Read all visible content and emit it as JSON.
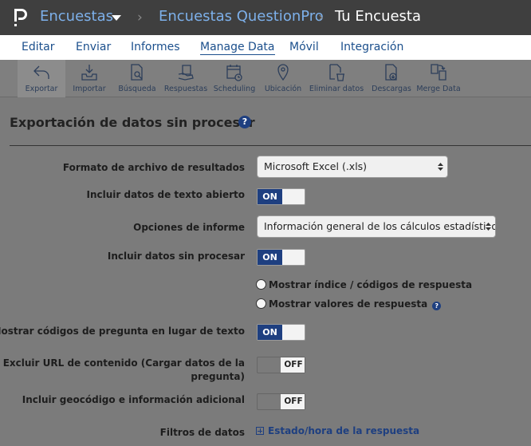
{
  "header": {
    "crumb1": "Encuestas",
    "crumb2": "Encuestas QuestionPro",
    "crumb3": "Tu Encuesta",
    "separator": "›"
  },
  "tabs": [
    {
      "label": "Editar"
    },
    {
      "label": "Enviar"
    },
    {
      "label": "Informes"
    },
    {
      "label": "Manage Data",
      "active": true
    },
    {
      "label": "Móvil"
    },
    {
      "label": "Integración"
    }
  ],
  "toolbar": [
    {
      "label": "Exportar",
      "icon": "export-arrow-icon",
      "active": true
    },
    {
      "label": "Importar",
      "icon": "import-tray-icon"
    },
    {
      "label": "Búsqueda",
      "icon": "search-document-icon"
    },
    {
      "label": "Respuestas",
      "icon": "responses-hand-icon"
    },
    {
      "label": "Scheduling",
      "icon": "calendar-icon"
    },
    {
      "label": "Ubicación",
      "icon": "location-pin-icon"
    },
    {
      "label": "Eliminar datos",
      "icon": "trash-icon"
    },
    {
      "label": "Descargas",
      "icon": "download-document-icon"
    },
    {
      "label": "Merge Data",
      "icon": "merge-documents-icon"
    }
  ],
  "page": {
    "title": "Exportación de datos sin procesar",
    "help": "?"
  },
  "form": {
    "format_label": "Formato de archivo de resultados",
    "format_value": "Microsoft Excel (.xls)",
    "open_text_label": "Incluir datos de texto abierto",
    "report_options_label": "Opciones de informe",
    "report_options_value": "Información general de los cálculos estadísticos y a",
    "raw_data_label": "Incluir datos sin procesar",
    "radio_index": "Mostrar índice / códigos de respuesta",
    "radio_values": "Mostrar valores de respuesta",
    "question_codes_label": "Mostrar códigos de pregunta en lugar de texto",
    "exclude_url_label_1": "Excluir URL de contenido (Cargar datos de la",
    "exclude_url_label_2": "pregunta)",
    "geocode_label": "Incluir geocódigo e información adicional",
    "filters_label": "Filtros de datos",
    "filter_link": "Estado/hora de la respuesta",
    "on_text": "ON",
    "off_text": "OFF"
  },
  "colors": {
    "topbar": "#3f3f3f",
    "link_blue": "#7db0ea",
    "accent": "#1e3f80",
    "overlay_gray": "#7b7b7b"
  }
}
